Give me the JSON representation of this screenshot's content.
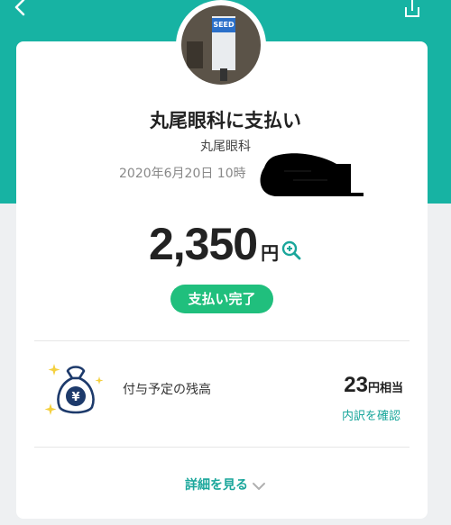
{
  "header": {
    "back_icon": "back-chevron-icon",
    "share_icon": "share-icon"
  },
  "merchant": {
    "avatar_sign_text": "SEED",
    "title": "丸尾眼科に支払い",
    "name": "丸尾眼科",
    "datetime": "2020年6月20日 10時"
  },
  "payment": {
    "amount": "2,350",
    "currency": "円",
    "zoom_icon": "zoom-in-icon",
    "status": "支払い完了"
  },
  "points": {
    "icon": "money-bag-icon",
    "label": "付与予定の残高",
    "value": "23",
    "unit": "円相当",
    "breakdown_link": "内訳を確認"
  },
  "footer": {
    "details_label": "詳細を見る",
    "details_icon": "chevron-down-icon"
  },
  "colors": {
    "header_teal": "#17b3a3",
    "status_green": "#20bf7d",
    "link_teal": "#19a69b",
    "icon_navy": "#1d3a6b",
    "sparkle_yellow": "#f4d03f"
  }
}
